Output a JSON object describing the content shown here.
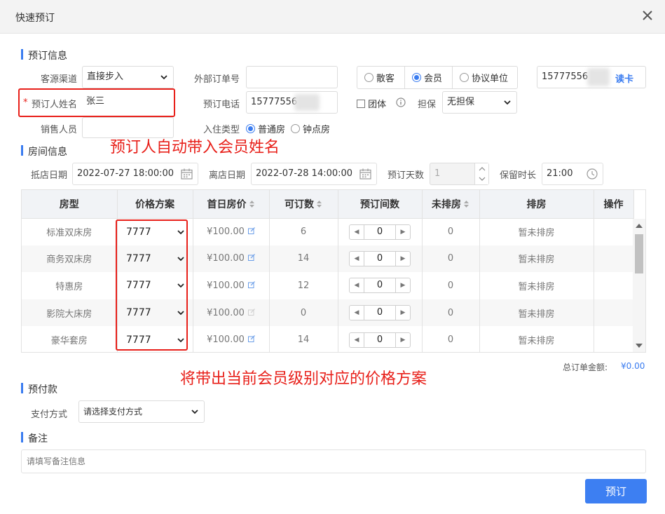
{
  "window": {
    "title": "快速预订"
  },
  "booking_info": {
    "section_title": "预订信息",
    "channel_label": "客源渠道",
    "channel_value": "直接步入",
    "ext_order_label": "外部订单号",
    "ext_order_value": "",
    "guest_types": [
      "散客",
      "会员",
      "协议单位"
    ],
    "guest_type_selected": "会员",
    "member_card_value": "15777556",
    "read_card_label": "读卡",
    "booker_name_label": "预订人姓名",
    "required_mark": "*",
    "booker_name_value": "张三",
    "phone_label": "预订电话",
    "phone_value": "15777556",
    "group_label": "团体",
    "guarantee_label": "担保",
    "guarantee_value": "无担保",
    "sales_label": "销售人员",
    "sales_value": "",
    "checkin_type_label": "入住类型",
    "checkin_types": [
      "普通房",
      "钟点房"
    ],
    "checkin_type_selected": "普通房"
  },
  "room_info": {
    "section_title": "房间信息",
    "arrive_label": "抵店日期",
    "arrive_value": "2022-07-27 18:00:00",
    "depart_label": "离店日期",
    "depart_value": "2022-07-28 14:00:00",
    "days_label": "预订天数",
    "days_value": "1",
    "keep_label": "保留时长",
    "keep_value": "21:00",
    "columns": [
      "房型",
      "价格方案",
      "首日房价",
      "可订数",
      "预订间数",
      "未排房",
      "排房",
      "操作"
    ],
    "rows": [
      {
        "type": "标准双床房",
        "plan": "7777",
        "price": "¥100.00",
        "available": "6",
        "qty": "0",
        "unassigned": "0",
        "assign": "暂未排房"
      },
      {
        "type": "商务双床房",
        "plan": "7777",
        "price": "¥100.00",
        "available": "14",
        "qty": "0",
        "unassigned": "0",
        "assign": "暂未排房"
      },
      {
        "type": "特惠房",
        "plan": "7777",
        "price": "¥100.00",
        "available": "12",
        "qty": "0",
        "unassigned": "0",
        "assign": "暂未排房"
      },
      {
        "type": "影院大床房",
        "plan": "7777",
        "price": "¥100.00",
        "available": "0",
        "qty": "0",
        "unassigned": "0",
        "assign": "暂未排房"
      },
      {
        "type": "豪华套房",
        "plan": "7777",
        "price": "¥100.00",
        "available": "14",
        "qty": "0",
        "unassigned": "0",
        "assign": "暂未排房"
      }
    ],
    "total_label": "总订单金额:",
    "total_value": "¥0.00"
  },
  "annotations": {
    "member_name_note": "预订人自动带入会员姓名",
    "price_plan_note": "将带出当前会员级别对应的价格方案"
  },
  "prepay": {
    "section_title": "预付款",
    "method_label": "支付方式",
    "method_value": "请选择支付方式"
  },
  "remarks": {
    "section_title": "备注",
    "placeholder": "请填写备注信息"
  },
  "actions": {
    "submit_label": "预订"
  },
  "colors": {
    "accent": "#3a7cf0",
    "annotation": "#e8201a",
    "button": "#3d7ff2"
  }
}
